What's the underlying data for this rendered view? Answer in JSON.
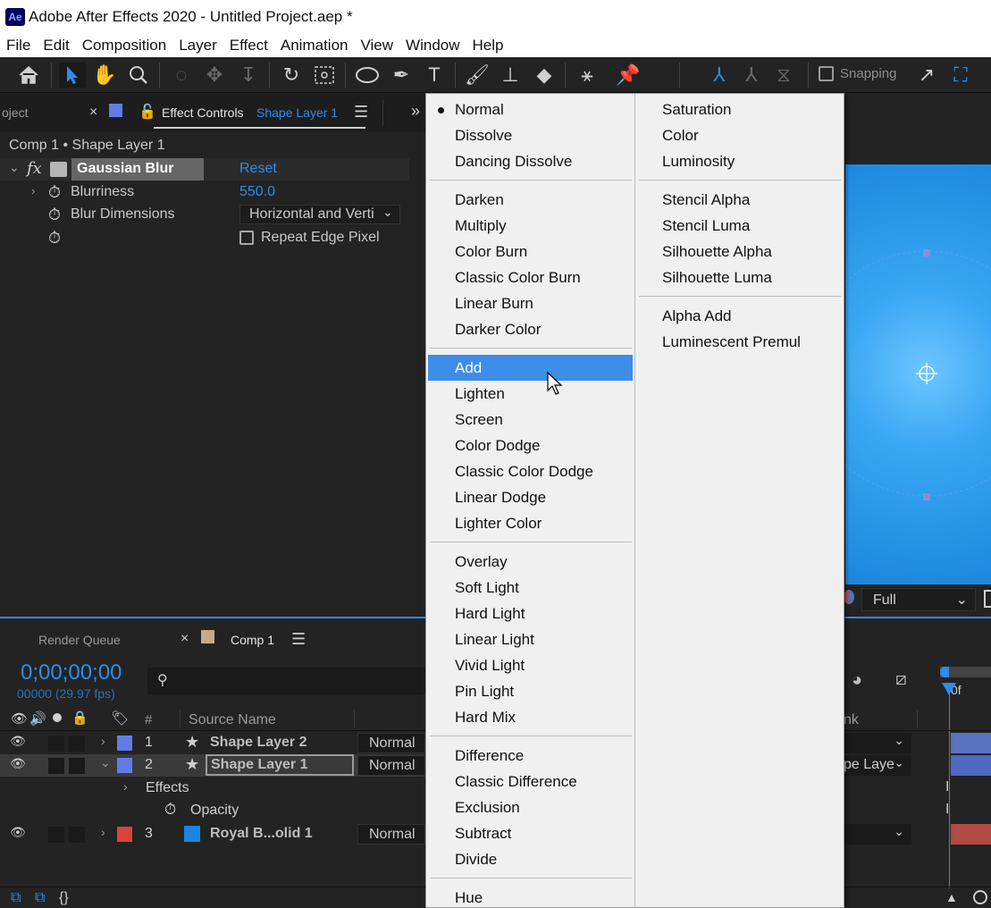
{
  "titlebar": {
    "logo": "Ae",
    "title": "Adobe After Effects 2020 - Untitled Project.aep *"
  },
  "menubar": [
    "File",
    "Edit",
    "Composition",
    "Layer",
    "Effect",
    "Animation",
    "View",
    "Window",
    "Help"
  ],
  "toolbar": {
    "snapping_label": "Snapping"
  },
  "effect_controls": {
    "left_tab": "oject",
    "tab_title": "Effect Controls",
    "tab_layer": "Shape Layer 1",
    "breadcrumb": "Comp 1 • Shape Layer 1",
    "effect_name": "Gaussian Blur",
    "reset_label": "Reset",
    "fx_label": "fx",
    "blurriness_label": "Blurriness",
    "blurriness_value": "550.0",
    "dimensions_label": "Blur Dimensions",
    "dimensions_value": "Horizontal and Verti",
    "repeat_edge_label": "Repeat Edge Pixel"
  },
  "comp_viewer": {
    "resolution": "Full"
  },
  "timeline": {
    "render_queue_tab": "Render Queue",
    "comp_tab": "Comp 1",
    "timecode": "0;00;00;00",
    "frame_info": "00000 (29.97 fps)",
    "col_number": "#",
    "col_source": "Source Name",
    "col_parent_partial": "nk",
    "ruler_label": "0f",
    "layers": [
      {
        "num": "1",
        "name": "Shape Layer 2",
        "mode": "Normal",
        "color": "#5f7ce8"
      },
      {
        "num": "2",
        "name": "Shape Layer 1",
        "mode": "Normal",
        "color": "#5f7ce8",
        "parent_partial": "pe Laye"
      },
      {
        "num": "3",
        "name": "Royal B...olid 1",
        "mode": "Normal",
        "color": "#d9433a"
      }
    ],
    "effects_label": "Effects",
    "opacity_label": "Opacity"
  },
  "blend_menu": {
    "col1": [
      [
        "Normal",
        "Dissolve",
        "Dancing Dissolve"
      ],
      [
        "Darken",
        "Multiply",
        "Color Burn",
        "Classic Color Burn",
        "Linear Burn",
        "Darker Color"
      ],
      [
        "Add",
        "Lighten",
        "Screen",
        "Color Dodge",
        "Classic Color Dodge",
        "Linear Dodge",
        "Lighter Color"
      ],
      [
        "Overlay",
        "Soft Light",
        "Hard Light",
        "Linear Light",
        "Vivid Light",
        "Pin Light",
        "Hard Mix"
      ],
      [
        "Difference",
        "Classic Difference",
        "Exclusion",
        "Subtract",
        "Divide"
      ],
      [
        "Hue"
      ]
    ],
    "col2": [
      [
        "Saturation",
        "Color",
        "Luminosity"
      ],
      [
        "Stencil Alpha",
        "Stencil Luma",
        "Silhouette Alpha",
        "Silhouette Luma"
      ],
      [
        "Alpha Add",
        "Luminescent Premul"
      ]
    ],
    "checked": "Normal",
    "highlighted": "Add"
  },
  "colors": {
    "accent": "#2d8ceb",
    "menu_highlight": "#3d8ee8",
    "panel_bg": "#232323"
  }
}
